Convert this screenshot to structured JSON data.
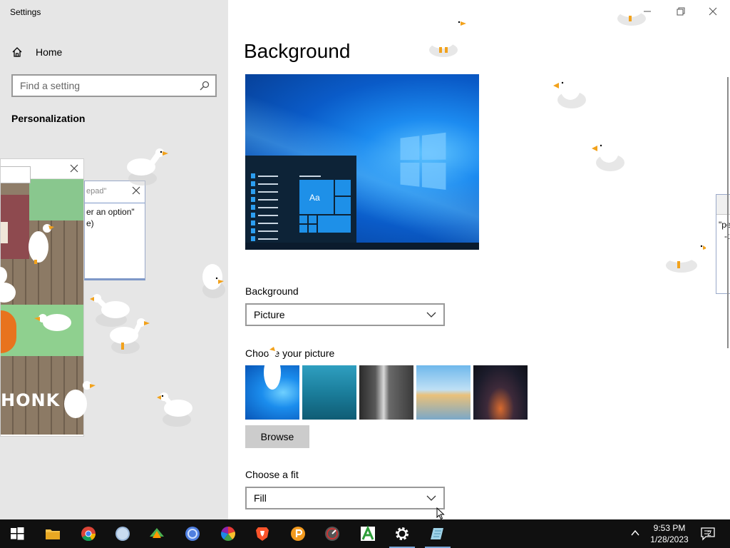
{
  "window": {
    "title": "Settings",
    "controls": [
      "minimize-icon",
      "maximize-icon",
      "close-icon"
    ]
  },
  "sidebar": {
    "home_label": "Home",
    "search_placeholder": "Find a setting",
    "section_title": "Personalization"
  },
  "main": {
    "page_title": "Background",
    "background_label": "Background",
    "background_value": "Picture",
    "choose_picture_label": "Choose your picture",
    "browse_label": "Browse",
    "fit_label": "Choose a fit",
    "fit_value": "Fill",
    "preview_tile_text": "Aa"
  },
  "overlays": {
    "notepad_title": "epad\"",
    "notepad_line1": "er an option\"",
    "notepad_line2": "e)",
    "game_text": "HONK",
    "right_window_line1": "\"pe",
    "right_window_line2": "-t"
  },
  "taskbar": {
    "items": [
      "windows-start-icon",
      "file-explorer-icon",
      "chrome-icon",
      "safari-icon",
      "app-icon",
      "circle-app-icon",
      "color-wheel-icon",
      "brave-icon",
      "orange-p-icon",
      "speed-icon",
      "green-a-icon",
      "settings-gear-icon",
      "notepad-icon"
    ],
    "time": "9:53 PM",
    "date": "1/28/2023",
    "notification_count": "2"
  },
  "colors": {
    "accent": "#0078d7",
    "sidebar_bg": "#e6e6e6",
    "taskbar_bg": "#101010"
  }
}
